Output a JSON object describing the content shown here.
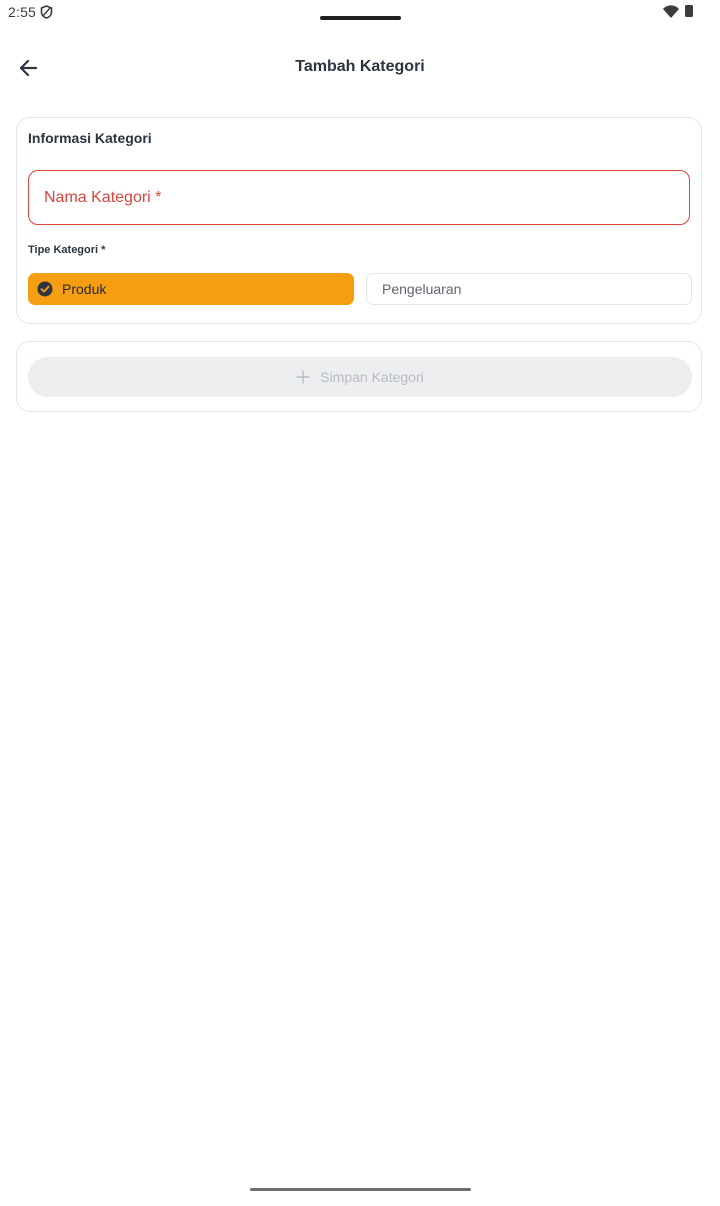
{
  "status_bar": {
    "time": "2:55",
    "icons": [
      "shield-icon",
      "wifi-icon",
      "battery-icon"
    ]
  },
  "app_bar": {
    "back_icon": "arrow-left-icon",
    "title": "Tambah Kategori"
  },
  "form": {
    "section_title": "Informasi Kategori",
    "name_field": {
      "placeholder": "Nama Kategori *",
      "value": ""
    },
    "type_label": "Tipe Kategori *",
    "type_options": [
      {
        "label": "Produk",
        "selected": true,
        "icon": "check-circle-icon"
      },
      {
        "label": "Pengeluaran",
        "selected": false
      }
    ]
  },
  "actions": {
    "save_label": "Simpan Kategori",
    "save_icon": "plus-icon",
    "save_enabled": false
  },
  "colors": {
    "accent": "#f59e12",
    "error": "#d9453b",
    "text_primary": "#2b3441",
    "disabled_bg": "#eceef0",
    "disabled_text": "#b8bcc2",
    "border": "#e3e5e8"
  }
}
